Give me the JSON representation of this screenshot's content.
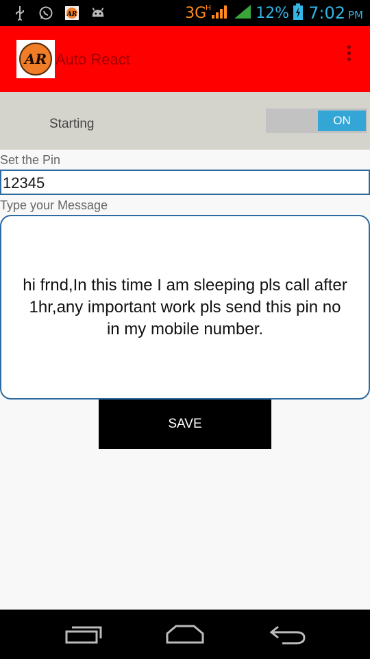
{
  "status_bar": {
    "network": "3G",
    "network_badge": "H",
    "battery_percent": "12%",
    "time": "7:02",
    "ampm": "PM",
    "icons": [
      "usb-icon",
      "whatsapp-icon",
      "app-notification-icon",
      "android-icon",
      "signal-icon",
      "battery-charging-icon"
    ]
  },
  "app_bar": {
    "logo_text": "AR",
    "title": "Auto React"
  },
  "toggle": {
    "label": "Starting",
    "state": "ON"
  },
  "form": {
    "pin_label": "Set the Pin",
    "pin_value": "12345",
    "message_label": "Type your Message",
    "message_value": "hi frnd,In this time I am sleeping pls call after 1hr,any important work pls send this pin no in my mobile number.",
    "save_label": "SAVE"
  },
  "colors": {
    "app_bar": "#ff0000",
    "toggle_row": "#d5d4cc",
    "switch_on": "#33a6d6",
    "input_border": "#2d6aa0",
    "status_accent": "#33b5e5"
  }
}
